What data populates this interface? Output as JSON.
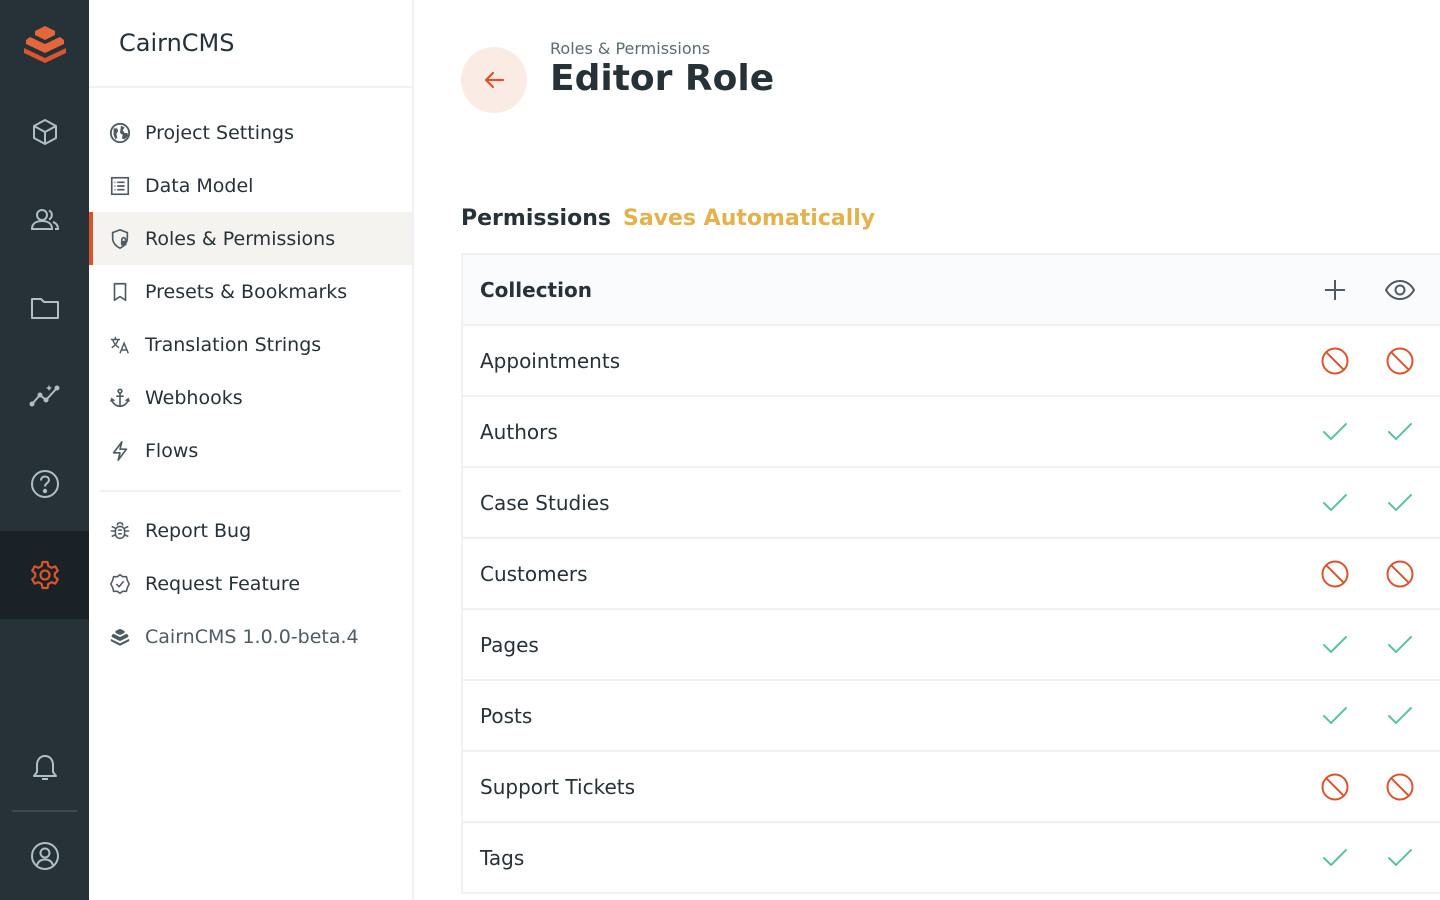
{
  "brand": {
    "accent": "#d9552e",
    "ok": "#5bc3a0",
    "warn": "#e4b24d"
  },
  "module_bar": {
    "items": [
      {
        "icon": "box-icon"
      },
      {
        "icon": "users-icon"
      },
      {
        "icon": "folder-icon"
      },
      {
        "icon": "insights-icon"
      },
      {
        "icon": "help-icon"
      },
      {
        "icon": "gear-icon",
        "active": true
      },
      {
        "icon": "bell-icon"
      },
      {
        "icon": "user-circle-icon"
      }
    ]
  },
  "nav": {
    "title": "CairnCMS",
    "items": [
      {
        "label": "Project Settings",
        "icon": "globe-icon"
      },
      {
        "label": "Data Model",
        "icon": "list-alt-icon"
      },
      {
        "label": "Roles & Permissions",
        "icon": "shield-lock-icon",
        "active": true
      },
      {
        "label": "Presets & Bookmarks",
        "icon": "bookmark-icon"
      },
      {
        "label": "Translation Strings",
        "icon": "translate-icon"
      },
      {
        "label": "Webhooks",
        "icon": "anchor-icon"
      },
      {
        "label": "Flows",
        "icon": "bolt-icon"
      }
    ],
    "secondary": [
      {
        "label": "Report Bug",
        "icon": "bug-icon"
      },
      {
        "label": "Request Feature",
        "icon": "verified-icon"
      },
      {
        "label": "CairnCMS 1.0.0-beta.4",
        "icon": "cairn-logo-icon"
      }
    ]
  },
  "header": {
    "breadcrumb": "Roles & Permissions",
    "title": "Editor Role"
  },
  "permissions": {
    "heading": "Permissions",
    "status": "Saves Automatically",
    "column_header": "Collection",
    "actions": [
      "plus-icon",
      "eye-icon"
    ],
    "rows": [
      {
        "name": "Appointments",
        "create": "none",
        "read": "none"
      },
      {
        "name": "Authors",
        "create": "all",
        "read": "all"
      },
      {
        "name": "Case Studies",
        "create": "all",
        "read": "all"
      },
      {
        "name": "Customers",
        "create": "none",
        "read": "none"
      },
      {
        "name": "Pages",
        "create": "all",
        "read": "all"
      },
      {
        "name": "Posts",
        "create": "all",
        "read": "all"
      },
      {
        "name": "Support Tickets",
        "create": "none",
        "read": "none"
      },
      {
        "name": "Tags",
        "create": "all",
        "read": "all"
      }
    ]
  }
}
